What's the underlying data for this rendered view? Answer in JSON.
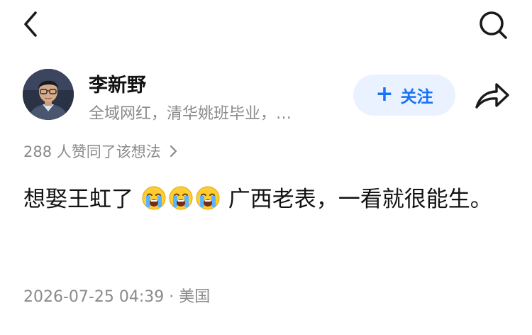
{
  "icons": {
    "back": "chevron-left-icon",
    "search": "search-icon",
    "share": "share-icon",
    "likes_more": "chevron-right-icon",
    "emoji": "loudly-crying-face-emoji"
  },
  "author": {
    "name": "李新野",
    "bio": "全域网红，清华姚班毕业，…"
  },
  "follow": {
    "plus": "+",
    "label": "关注"
  },
  "likes": {
    "text": "288 人赞同了该想法"
  },
  "post": {
    "text_before": "想娶王虹了",
    "emoji": "😭😭😭",
    "text_after": "广西老表，一看就很能生。"
  },
  "meta": {
    "datetime": "2026-07-25 04:39",
    "separator": " · ",
    "location": "美国"
  },
  "colors": {
    "accent": "#1772f6",
    "follow_bg": "#ebf2ff",
    "secondary_text": "#8a8a8a",
    "primary_text": "#121212"
  }
}
